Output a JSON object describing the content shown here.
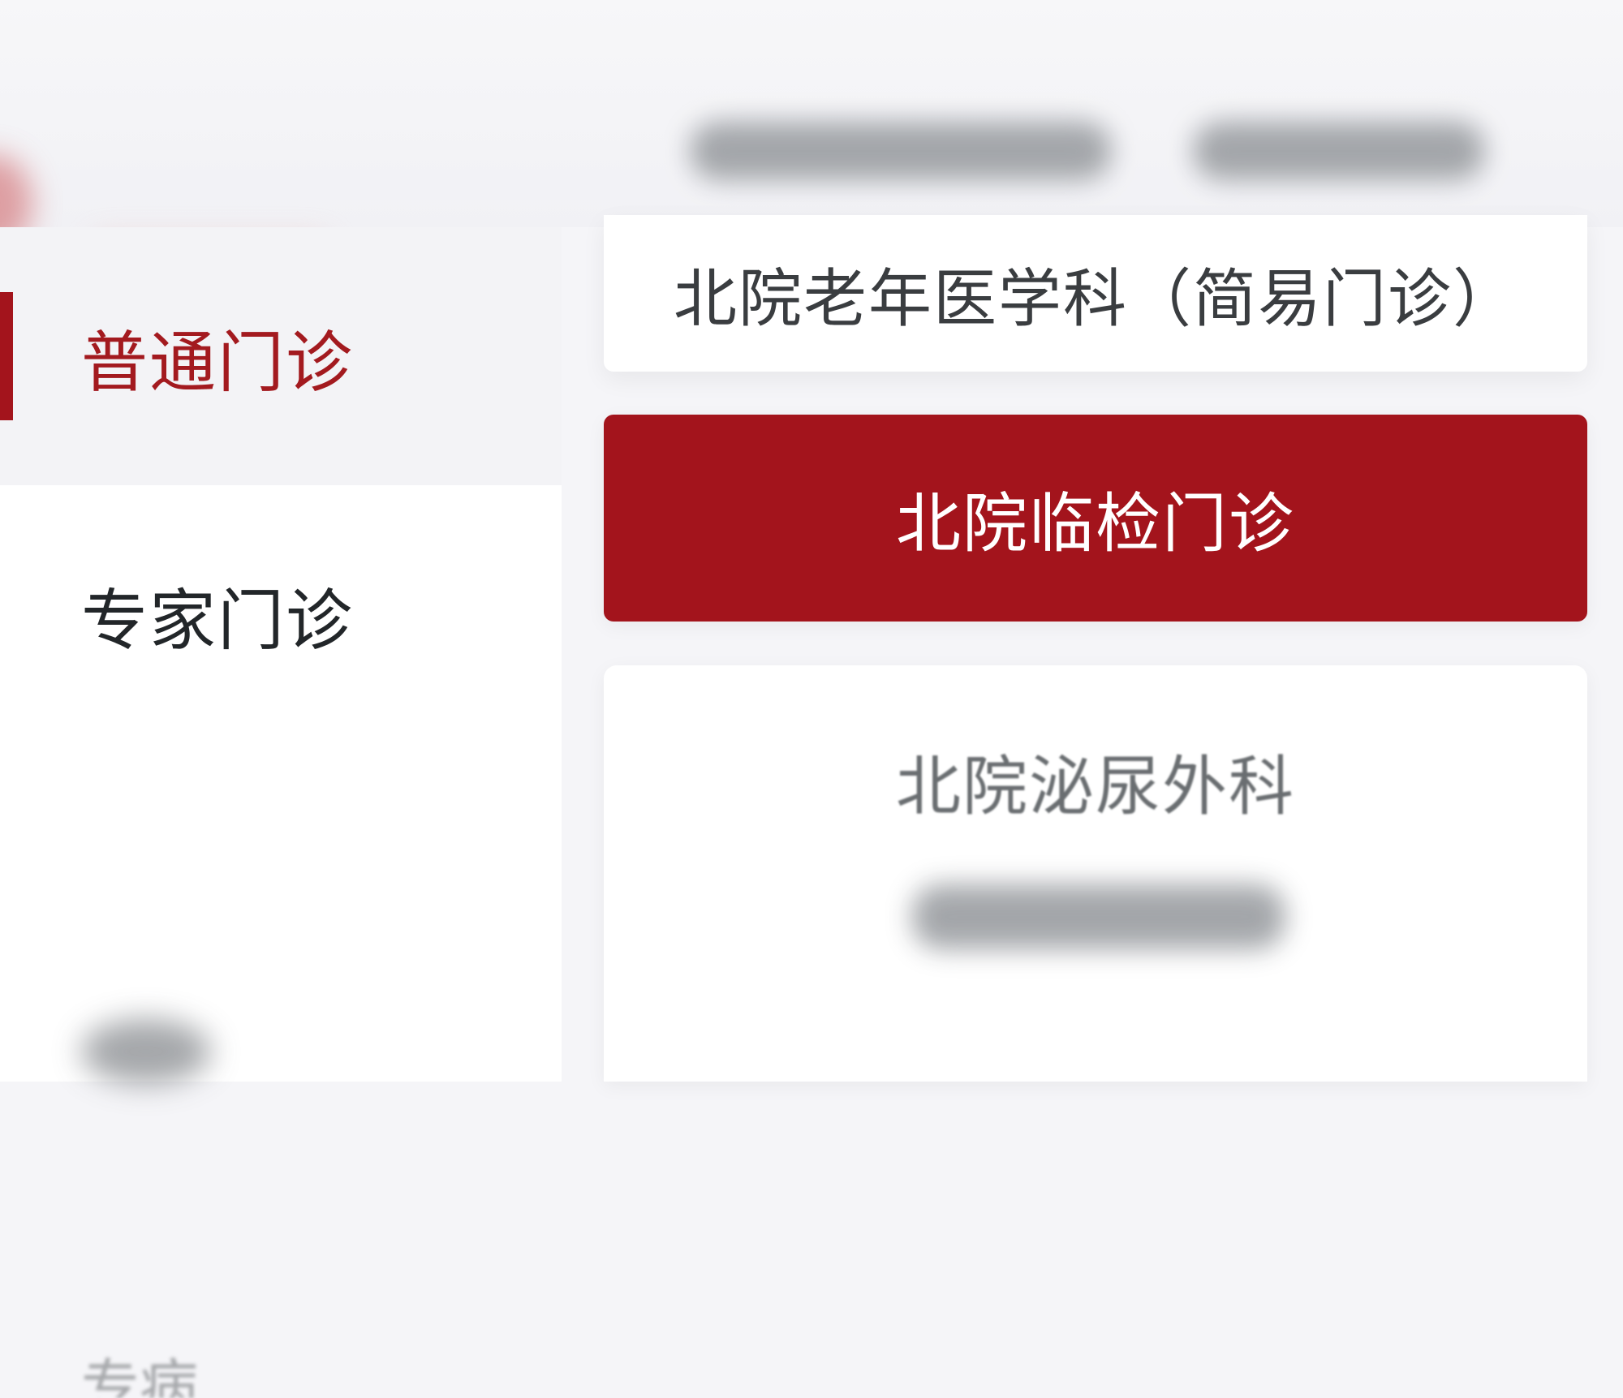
{
  "sidebar": {
    "items": [
      {
        "label": "普通门诊",
        "active": true
      },
      {
        "label": "专家门诊",
        "active": false
      },
      {
        "label": "专病",
        "active": false
      }
    ]
  },
  "departments": [
    {
      "label": "北院老年医学科（简易门诊）",
      "selected": false
    },
    {
      "label": "北院临检门诊",
      "selected": true
    },
    {
      "label": "北院泌尿外科",
      "selected": false
    }
  ],
  "colors": {
    "accent": "#a3141c",
    "active_text": "#a31a1f",
    "text_primary": "#222629",
    "background": "#f3f3f6"
  }
}
